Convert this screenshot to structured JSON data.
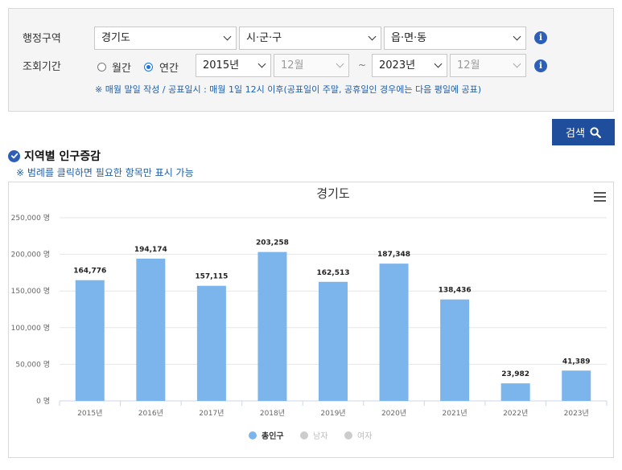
{
  "filter": {
    "region_label": "행정구역",
    "period_label": "조회기간",
    "province": "경기도",
    "city_placeholder": "시·군·구",
    "town_placeholder": "읍·면·동",
    "monthly_label": "월간",
    "yearly_label": "연간",
    "period_mode": "연간",
    "start_year": "2015년",
    "start_month": "12월",
    "tilde": "~",
    "end_year": "2023년",
    "end_month": "12월",
    "info_glyph": "i",
    "note": "※ 매월 말일 작성 / 공표일시 : 매월 1일 12시 이후(공표일이 주말, 공휴일인 경우에는 다음 평일에 공표)"
  },
  "search_label": "검색",
  "section": {
    "title": "지역별 인구증감",
    "hint": "※ 범례를 클릭하면 필요한 항목만 표시 가능"
  },
  "colors": {
    "bar": "#7cb5ec",
    "legend_inactive": "#cccccc",
    "accent": "#1f4f9c"
  },
  "chart_data": {
    "type": "bar",
    "title": "경기도",
    "categories": [
      "2015년",
      "2016년",
      "2017년",
      "2018년",
      "2019년",
      "2020년",
      "2021년",
      "2022년",
      "2023년"
    ],
    "series": [
      {
        "name": "총인구",
        "values": [
          164776,
          194174,
          157115,
          203258,
          162513,
          187348,
          138436,
          23982,
          41389
        ],
        "visible": true
      },
      {
        "name": "남자",
        "values": [],
        "visible": false
      },
      {
        "name": "여자",
        "values": [],
        "visible": false
      }
    ],
    "data_labels": [
      "164,776",
      "194,174",
      "157,115",
      "203,258",
      "162,513",
      "187,348",
      "138,436",
      "23,982",
      "41,389"
    ],
    "y_ticks": [
      0,
      50000,
      100000,
      150000,
      200000,
      250000
    ],
    "y_tick_labels": [
      "0 명",
      "50,000 명",
      "100,000 명",
      "150,000 명",
      "200,000 명",
      "250,000 명"
    ],
    "ylim": [
      0,
      250000
    ],
    "grid": true,
    "legend_position": "bottom"
  }
}
